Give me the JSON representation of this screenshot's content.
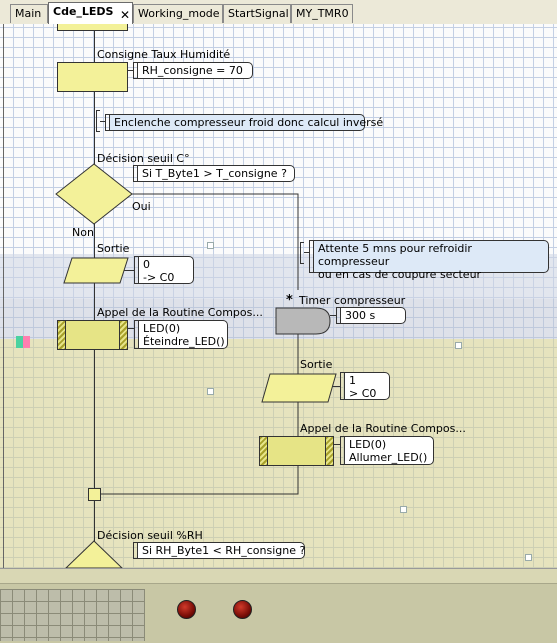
{
  "tabs": [
    {
      "label": "Main",
      "active": false
    },
    {
      "label": "Cde_LEDS",
      "active": true
    },
    {
      "label": "Working_mode",
      "active": false
    },
    {
      "label": "StartSignal",
      "active": false
    },
    {
      "label": "MY_TMR0",
      "active": false
    }
  ],
  "flowchart": {
    "consigne_title": "Consigne Taux Humidité",
    "consigne_value": "RH_consigne = 70",
    "comment_compresseur": "Enclenche compresseur froid donc calcul inversé",
    "decision_temp_title": "Décision seuil C°",
    "decision_temp_condition": "Si  T_Byte1 > T_consigne ?",
    "branch_yes": "Oui",
    "branch_no": "Non",
    "sortie_left_title": "Sortie",
    "sortie_left_value1": "0",
    "sortie_left_value2": "-> C0",
    "routine_left_title": "Appel de la Routine Compos...",
    "routine_left_arg1": "LED(0)",
    "routine_left_arg2": "Éteindre_LED()",
    "comment_attente_line1": "Attente 5 mns pour refroidir compresseur",
    "comment_attente_line2": "ou en cas de coupure secteur",
    "timer_title": "Timer compresseur",
    "timer_value": "300 s",
    "sortie_right_title": "Sortie",
    "sortie_right_value1": "1",
    "sortie_right_value2": "> C0",
    "routine_right_title": "Appel de la Routine Compos...",
    "routine_right_arg1": "LED(0)",
    "routine_right_arg2": "Allumer_LED()",
    "decision_rh_title": "Décision seuil %RH",
    "decision_rh_condition": "Si  RH_Byte1 < RH_consigne ?"
  },
  "colors": {
    "block_fill": "#f3f199",
    "routine_fill": "#e6e486",
    "comment_blue": "#dde9f7",
    "led": "#c0281c"
  },
  "icons": {
    "tab_close": "close-icon",
    "led_left": "led-icon",
    "led_right": "led-icon"
  }
}
